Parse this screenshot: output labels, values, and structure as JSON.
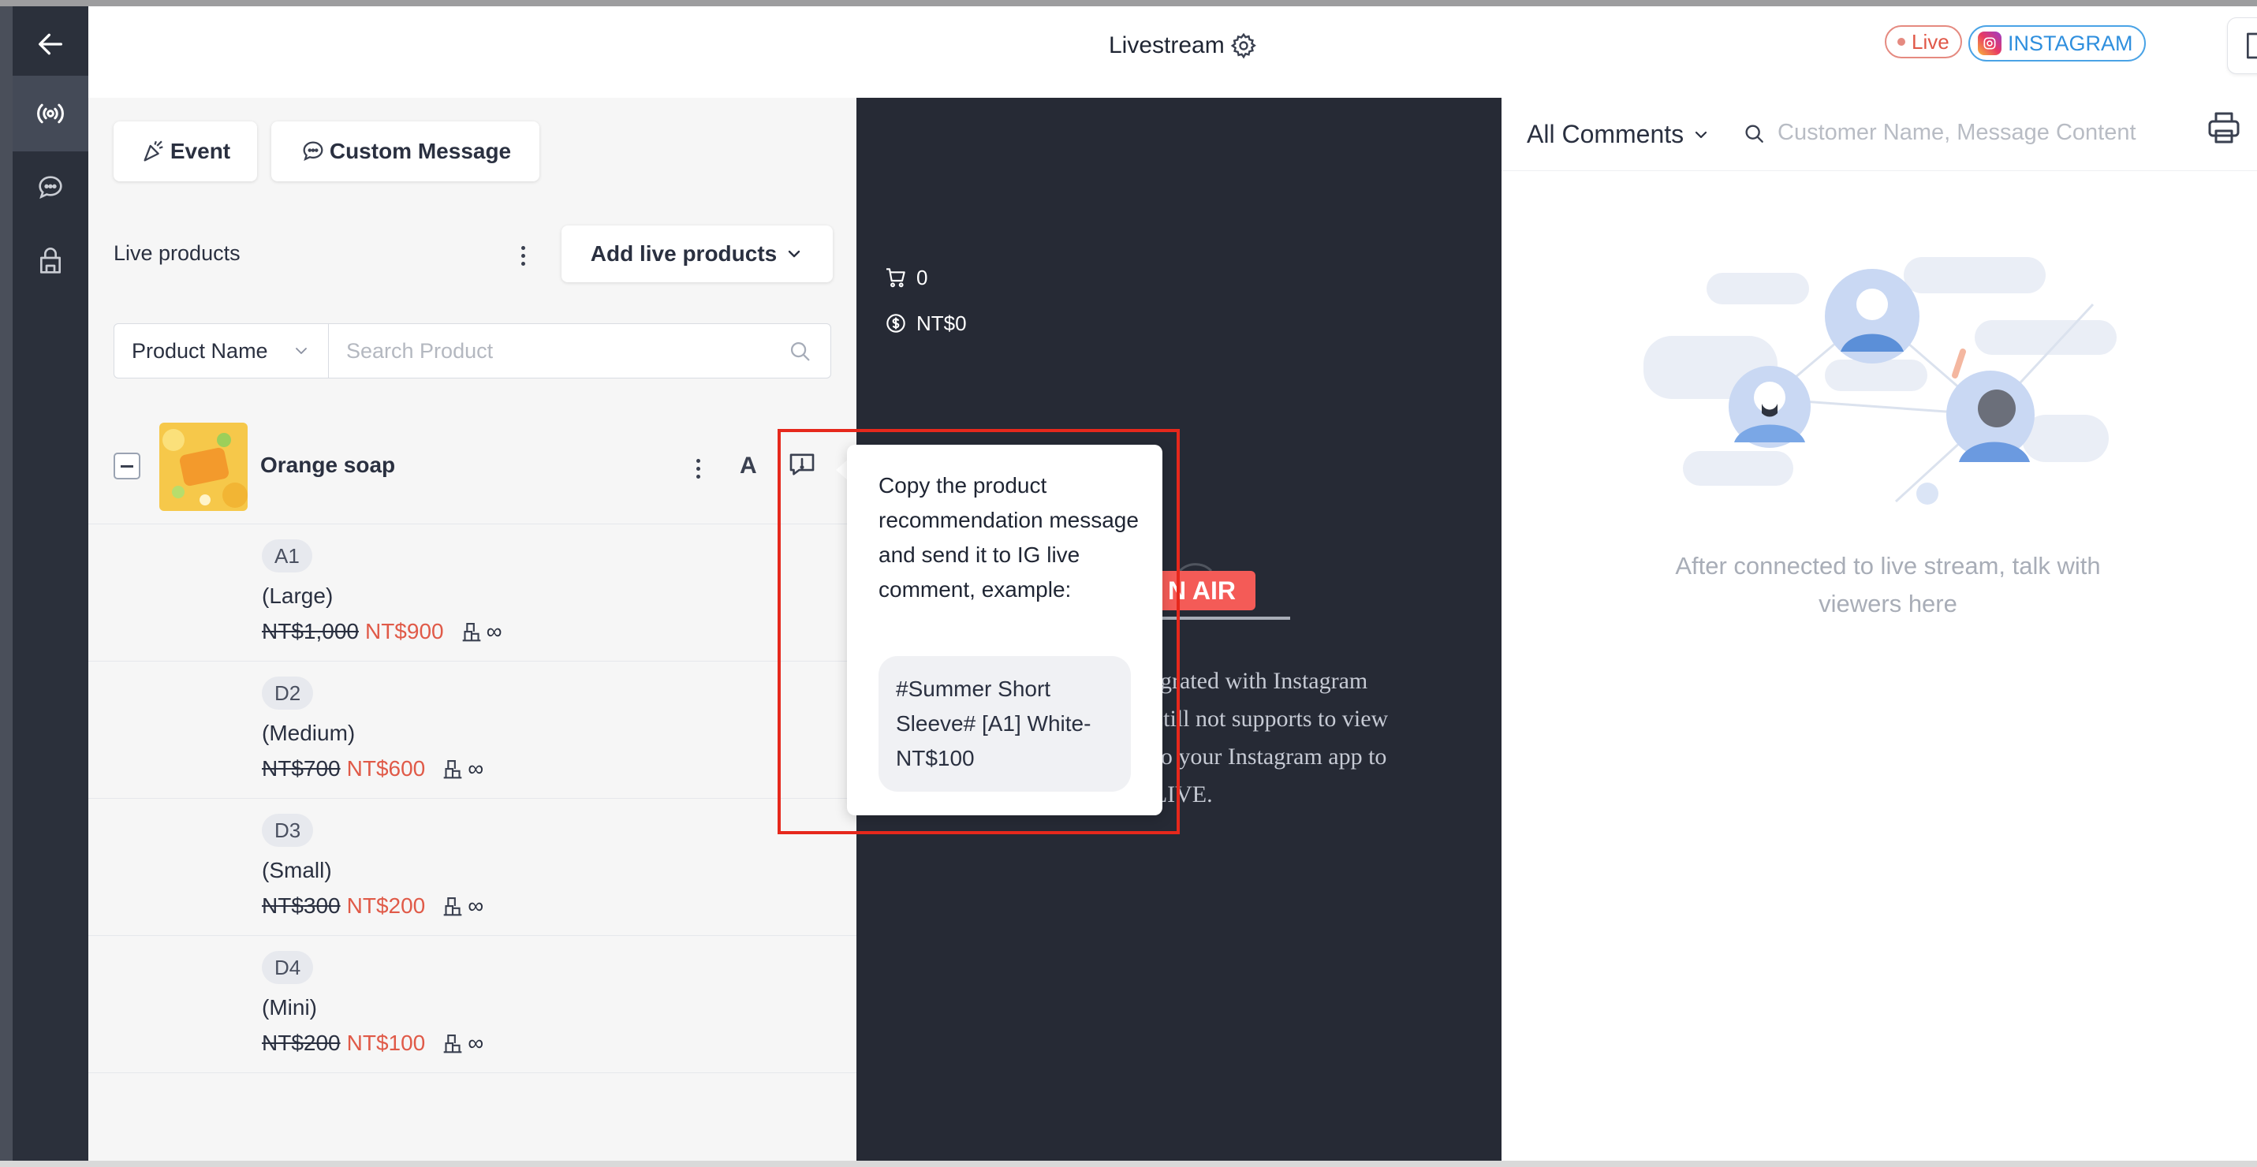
{
  "header": {
    "title": "Livestream",
    "live_label": "Live",
    "platform_label": "INSTAGRAM"
  },
  "sidebar": {
    "items": [
      "back-icon",
      "livestream-icon",
      "chat-icon",
      "store-icon"
    ],
    "active_item": "livestream-icon"
  },
  "toolbar": {
    "event_label": "Event",
    "custom_message_label": "Custom Message"
  },
  "live_products": {
    "title": "Live products",
    "add_button_label": "Add live products",
    "filter_select_value": "Product Name",
    "search_placeholder": "Search Product",
    "product": {
      "name": "Orange soap",
      "letter_button": "A",
      "variants": [
        {
          "code": "A1",
          "size": "(Large)",
          "old_price": "NT$1,000",
          "new_price": "NT$900",
          "stock": "∞"
        },
        {
          "code": "D2",
          "size": "(Medium)",
          "old_price": "NT$700",
          "new_price": "NT$600",
          "stock": "∞"
        },
        {
          "code": "D3",
          "size": "(Small)",
          "old_price": "NT$300",
          "new_price": "NT$200",
          "stock": "∞"
        },
        {
          "code": "D4",
          "size": "(Mini)",
          "old_price": "NT$200",
          "new_price": "NT$100",
          "stock": "∞"
        }
      ]
    }
  },
  "stream": {
    "cart_count": "0",
    "revenue": "NT$0",
    "badge_text": "N AIR",
    "message_lines": [
      "integrated with Instagram",
      "on still not supports to view",
      "go to your Instagram app to",
      "he LIVE."
    ]
  },
  "tooltip": {
    "text": "Copy the product recommendation message and send it to IG live comment, example:",
    "example": "#Summer Short Sleeve# [A1] White-NT$100"
  },
  "comments": {
    "filter_label": "All Comments",
    "search_placeholder": "Customer Name, Message Content",
    "empty_text": "After connected to live stream, talk with viewers here"
  },
  "colors": {
    "sidebar_bg": "#2b303b",
    "stream_bg": "#262a35",
    "accent_red": "#e05a48",
    "instagram_blue": "#2f8fde",
    "highlight_box": "#e6281c"
  }
}
